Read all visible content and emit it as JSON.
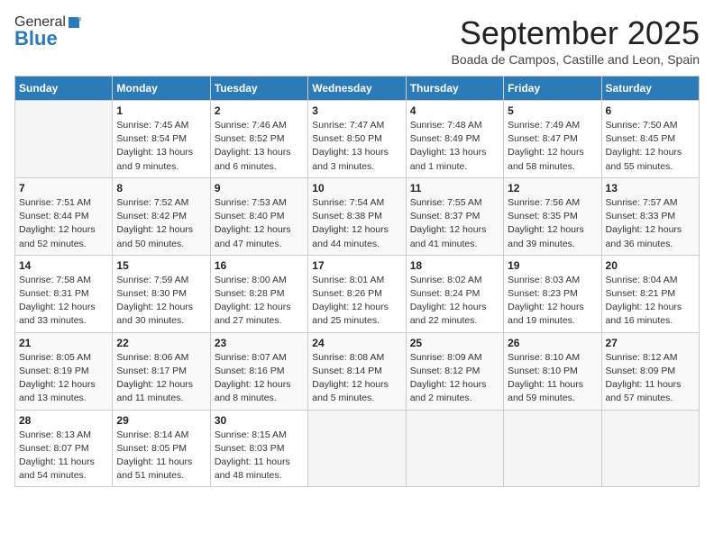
{
  "logo": {
    "general": "General",
    "blue": "Blue"
  },
  "title": "September 2025",
  "location": "Boada de Campos, Castille and Leon, Spain",
  "headers": [
    "Sunday",
    "Monday",
    "Tuesday",
    "Wednesday",
    "Thursday",
    "Friday",
    "Saturday"
  ],
  "weeks": [
    [
      {
        "day": "",
        "info": ""
      },
      {
        "day": "1",
        "info": "Sunrise: 7:45 AM\nSunset: 8:54 PM\nDaylight: 13 hours\nand 9 minutes."
      },
      {
        "day": "2",
        "info": "Sunrise: 7:46 AM\nSunset: 8:52 PM\nDaylight: 13 hours\nand 6 minutes."
      },
      {
        "day": "3",
        "info": "Sunrise: 7:47 AM\nSunset: 8:50 PM\nDaylight: 13 hours\nand 3 minutes."
      },
      {
        "day": "4",
        "info": "Sunrise: 7:48 AM\nSunset: 8:49 PM\nDaylight: 13 hours\nand 1 minute."
      },
      {
        "day": "5",
        "info": "Sunrise: 7:49 AM\nSunset: 8:47 PM\nDaylight: 12 hours\nand 58 minutes."
      },
      {
        "day": "6",
        "info": "Sunrise: 7:50 AM\nSunset: 8:45 PM\nDaylight: 12 hours\nand 55 minutes."
      }
    ],
    [
      {
        "day": "7",
        "info": "Sunrise: 7:51 AM\nSunset: 8:44 PM\nDaylight: 12 hours\nand 52 minutes."
      },
      {
        "day": "8",
        "info": "Sunrise: 7:52 AM\nSunset: 8:42 PM\nDaylight: 12 hours\nand 50 minutes."
      },
      {
        "day": "9",
        "info": "Sunrise: 7:53 AM\nSunset: 8:40 PM\nDaylight: 12 hours\nand 47 minutes."
      },
      {
        "day": "10",
        "info": "Sunrise: 7:54 AM\nSunset: 8:38 PM\nDaylight: 12 hours\nand 44 minutes."
      },
      {
        "day": "11",
        "info": "Sunrise: 7:55 AM\nSunset: 8:37 PM\nDaylight: 12 hours\nand 41 minutes."
      },
      {
        "day": "12",
        "info": "Sunrise: 7:56 AM\nSunset: 8:35 PM\nDaylight: 12 hours\nand 39 minutes."
      },
      {
        "day": "13",
        "info": "Sunrise: 7:57 AM\nSunset: 8:33 PM\nDaylight: 12 hours\nand 36 minutes."
      }
    ],
    [
      {
        "day": "14",
        "info": "Sunrise: 7:58 AM\nSunset: 8:31 PM\nDaylight: 12 hours\nand 33 minutes."
      },
      {
        "day": "15",
        "info": "Sunrise: 7:59 AM\nSunset: 8:30 PM\nDaylight: 12 hours\nand 30 minutes."
      },
      {
        "day": "16",
        "info": "Sunrise: 8:00 AM\nSunset: 8:28 PM\nDaylight: 12 hours\nand 27 minutes."
      },
      {
        "day": "17",
        "info": "Sunrise: 8:01 AM\nSunset: 8:26 PM\nDaylight: 12 hours\nand 25 minutes."
      },
      {
        "day": "18",
        "info": "Sunrise: 8:02 AM\nSunset: 8:24 PM\nDaylight: 12 hours\nand 22 minutes."
      },
      {
        "day": "19",
        "info": "Sunrise: 8:03 AM\nSunset: 8:23 PM\nDaylight: 12 hours\nand 19 minutes."
      },
      {
        "day": "20",
        "info": "Sunrise: 8:04 AM\nSunset: 8:21 PM\nDaylight: 12 hours\nand 16 minutes."
      }
    ],
    [
      {
        "day": "21",
        "info": "Sunrise: 8:05 AM\nSunset: 8:19 PM\nDaylight: 12 hours\nand 13 minutes."
      },
      {
        "day": "22",
        "info": "Sunrise: 8:06 AM\nSunset: 8:17 PM\nDaylight: 12 hours\nand 11 minutes."
      },
      {
        "day": "23",
        "info": "Sunrise: 8:07 AM\nSunset: 8:16 PM\nDaylight: 12 hours\nand 8 minutes."
      },
      {
        "day": "24",
        "info": "Sunrise: 8:08 AM\nSunset: 8:14 PM\nDaylight: 12 hours\nand 5 minutes."
      },
      {
        "day": "25",
        "info": "Sunrise: 8:09 AM\nSunset: 8:12 PM\nDaylight: 12 hours\nand 2 minutes."
      },
      {
        "day": "26",
        "info": "Sunrise: 8:10 AM\nSunset: 8:10 PM\nDaylight: 11 hours\nand 59 minutes."
      },
      {
        "day": "27",
        "info": "Sunrise: 8:12 AM\nSunset: 8:09 PM\nDaylight: 11 hours\nand 57 minutes."
      }
    ],
    [
      {
        "day": "28",
        "info": "Sunrise: 8:13 AM\nSunset: 8:07 PM\nDaylight: 11 hours\nand 54 minutes."
      },
      {
        "day": "29",
        "info": "Sunrise: 8:14 AM\nSunset: 8:05 PM\nDaylight: 11 hours\nand 51 minutes."
      },
      {
        "day": "30",
        "info": "Sunrise: 8:15 AM\nSunset: 8:03 PM\nDaylight: 11 hours\nand 48 minutes."
      },
      {
        "day": "",
        "info": ""
      },
      {
        "day": "",
        "info": ""
      },
      {
        "day": "",
        "info": ""
      },
      {
        "day": "",
        "info": ""
      }
    ]
  ]
}
